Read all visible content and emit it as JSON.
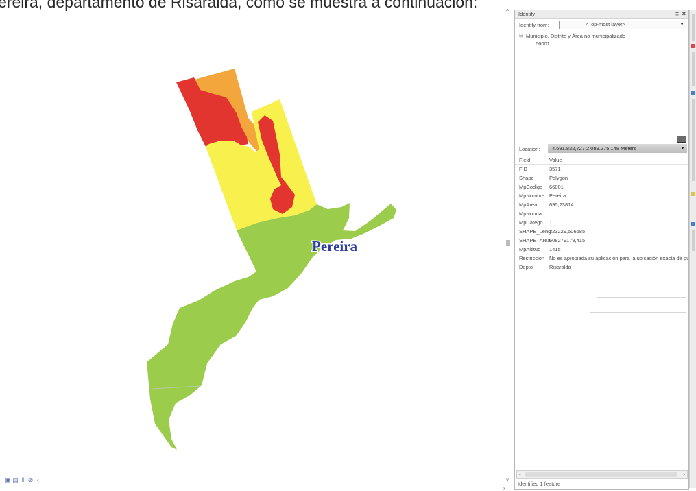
{
  "document": {
    "text_line": "ereira, departamento de Risaralda, como se muestra a continuación:"
  },
  "map": {
    "label": "Pereira",
    "colors": {
      "green": "#9ccc4c",
      "yellow": "#f7f04d",
      "red": "#e2352f",
      "orange": "#f2a63c",
      "label": "#2d3e9e",
      "label_halo": "#ffffff",
      "boundary": "#b9c9a0"
    }
  },
  "identify": {
    "title": "Identify",
    "from_label": "Identify from:",
    "from_value": "<Top-most layer>",
    "tree": {
      "layer": "Municipio, Distrito y Área no municipalizado",
      "feature": "66001"
    },
    "location_label": "Location:",
    "location_value": "4.691.832,727  2.089.275,148 Meters",
    "columns": {
      "field": "Field",
      "value": "Value"
    },
    "rows": [
      {
        "field": "FID",
        "value": "3571"
      },
      {
        "field": "Shape",
        "value": "Polygon"
      },
      {
        "field": "MpCodigo",
        "value": "66001"
      },
      {
        "field": "MpNombre",
        "value": "Pereira"
      },
      {
        "field": "MpArea",
        "value": "695,23814"
      },
      {
        "field": "MpNorma",
        "value": ""
      },
      {
        "field": "MpCatego",
        "value": "1"
      },
      {
        "field": "SHAPE_Leng",
        "value": "223229,506685"
      },
      {
        "field": "SHAPE_Area",
        "value": "608279179,415"
      },
      {
        "field": "MpAltitud",
        "value": "1415"
      },
      {
        "field": "Restriccion",
        "value": "No es apropiada su aplicación para la ubicación exacta de pun"
      },
      {
        "field": "Depto",
        "value": "Risaralda"
      }
    ],
    "status": "Identified 1 feature"
  },
  "icons": {
    "pin": "pin-icon",
    "close": "close-icon",
    "dropdown": "chevron-down-icon",
    "tree_toggle": "collapse-icon",
    "scroll_left": "chevron-left-icon",
    "scroll_right": "chevron-right-icon",
    "map_tools": [
      "data-view-icon",
      "layout-view-icon",
      "pause-icon",
      "refresh-icon",
      "back-icon"
    ]
  }
}
